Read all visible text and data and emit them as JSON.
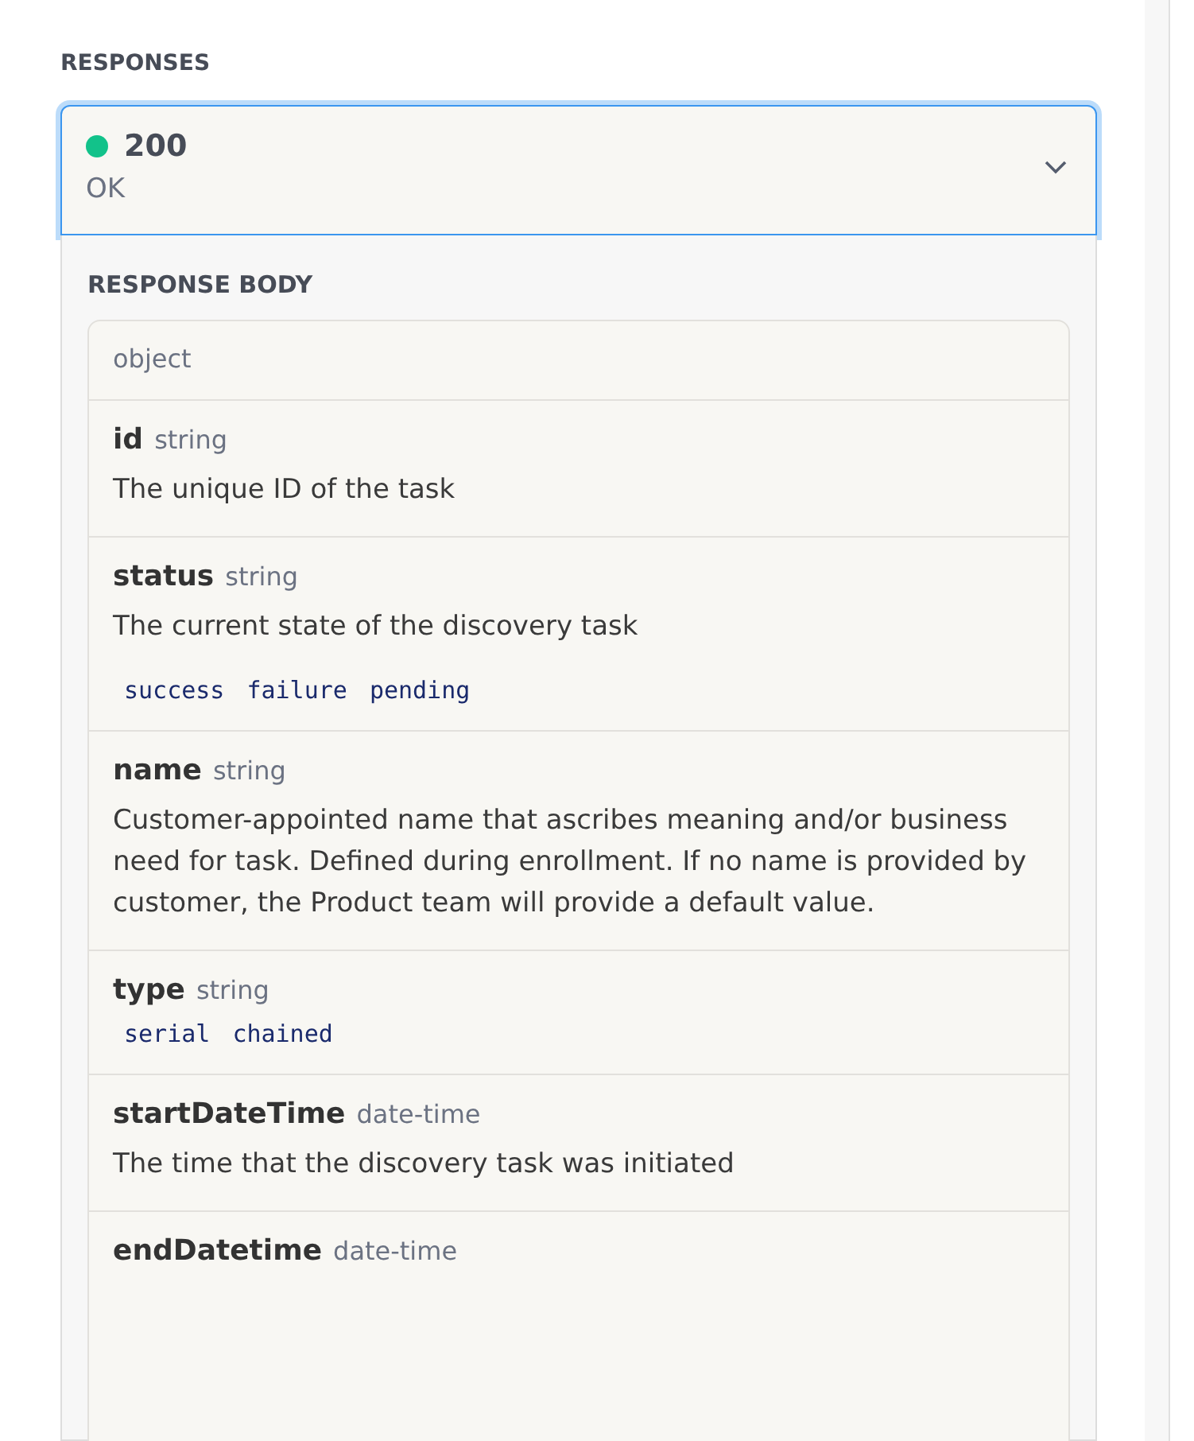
{
  "section_title": "RESPONSES",
  "response": {
    "code": "200",
    "message": "OK",
    "color": "#12c28a",
    "expanded": true
  },
  "body_title": "RESPONSE BODY",
  "schema_type": "object",
  "fields": [
    {
      "name": "id",
      "type": "string",
      "description": "The unique ID of the task"
    },
    {
      "name": "status",
      "type": "string",
      "description": "The current state of the discovery task",
      "enum": [
        "success",
        "failure",
        "pending"
      ]
    },
    {
      "name": "name",
      "type": "string",
      "description": "Customer-appointed name that ascribes meaning and/or business need for task. Defined during enrollment. If no name is provided by customer, the Product team will provide a default value."
    },
    {
      "name": "type",
      "type": "string",
      "enum": [
        "serial",
        "chained"
      ]
    },
    {
      "name": "startDateTime",
      "type": "date-time",
      "description": "The time that the discovery task was initiated"
    },
    {
      "name": "endDatetime",
      "type": "date-time"
    }
  ]
}
